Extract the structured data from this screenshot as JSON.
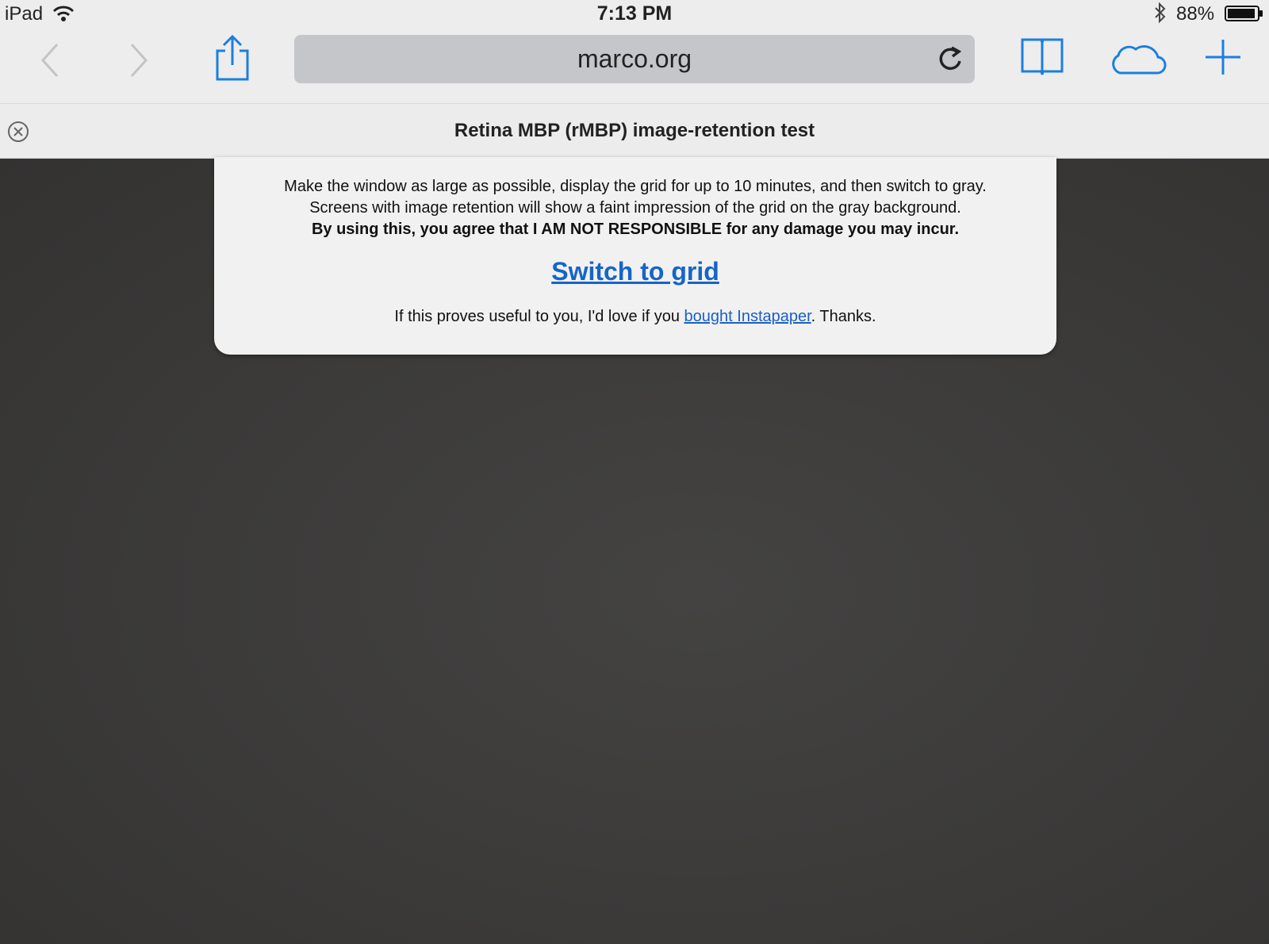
{
  "status_bar": {
    "device_name": "iPad",
    "time": "7:13 PM",
    "battery": "88%"
  },
  "toolbar": {
    "url": "marco.org"
  },
  "tab": {
    "title": "Retina MBP (rMBP) image-retention test"
  },
  "content": {
    "instruction_line_1": "Make the window as large as possible, display the grid for up to 10 minutes, and then switch to gray.",
    "instruction_line_2": "Screens with image retention will show a faint impression of the grid on the gray background.",
    "disclaimer": "By using this, you agree that I AM NOT RESPONSIBLE for any damage you may incur.",
    "switch_link": "Switch to grid",
    "thanks_prefix": "If this proves useful to you, I'd love if you ",
    "instapaper_link": "bought Instapaper",
    "thanks_suffix": ". Thanks."
  },
  "colors": {
    "accent": "#1a7fe0",
    "link": "#1565c8",
    "page_background": "#3a3a3a"
  },
  "icons": [
    "wifi-icon",
    "bluetooth-icon",
    "battery-icon",
    "back-chevron-icon",
    "forward-chevron-icon",
    "share-icon",
    "reload-icon",
    "bookmarks-icon",
    "cloud-icon",
    "plus-icon",
    "close-circle-icon"
  ]
}
